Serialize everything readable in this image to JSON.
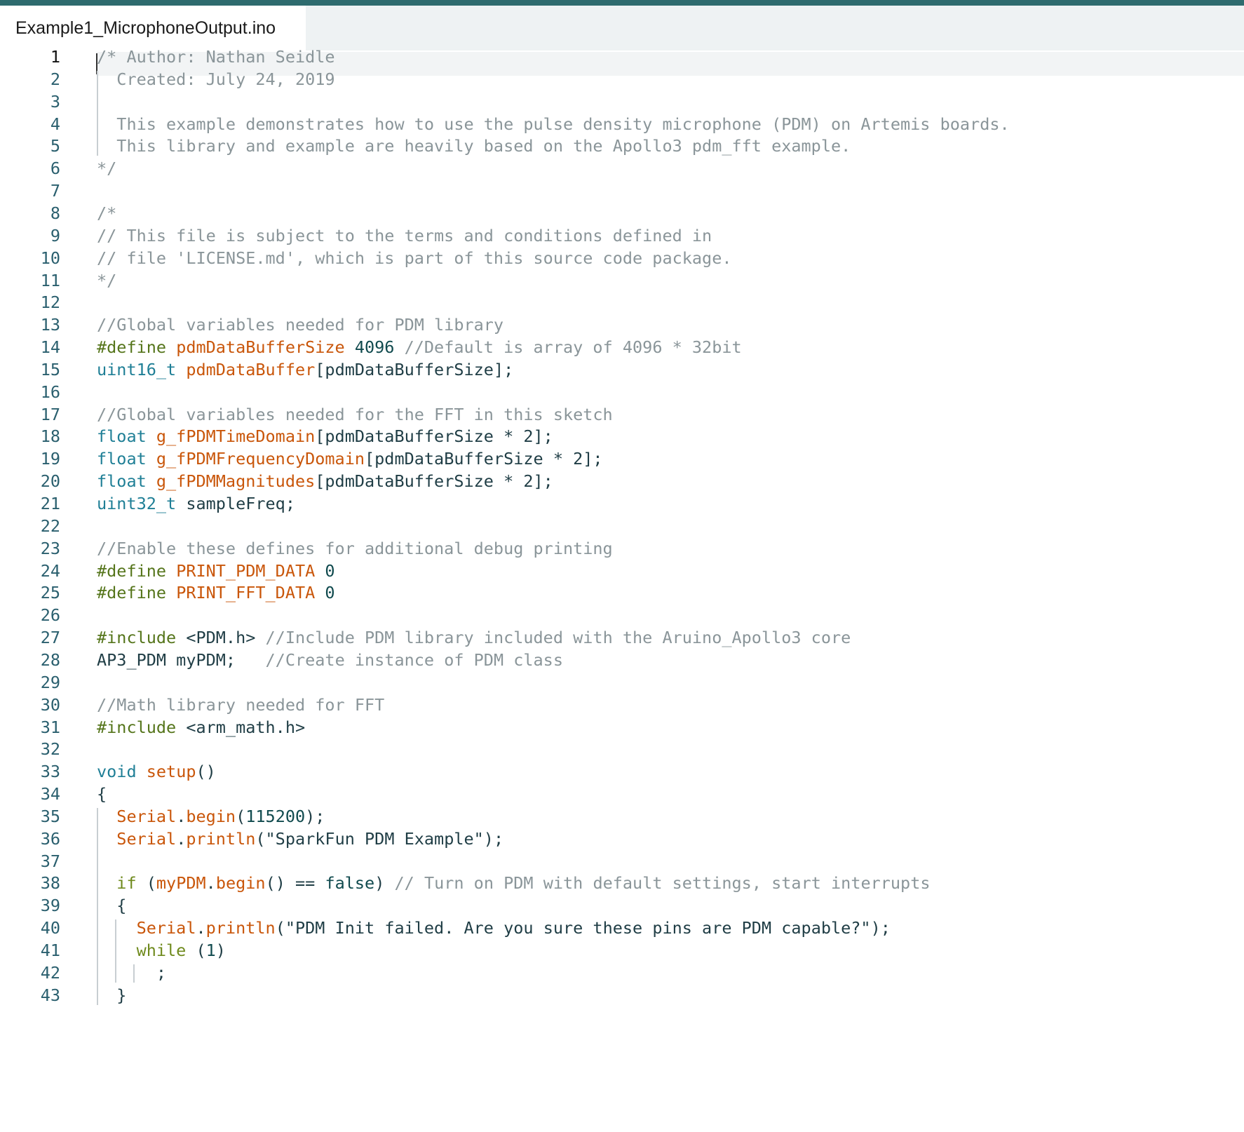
{
  "editor": {
    "tab_label": "Example1_MicrophoneOutput.ino",
    "active_line": 1,
    "colors": {
      "top_bar": "#2e6b6e",
      "comment": "#8a9599",
      "directive": "#55751b",
      "type": "#1f7f96",
      "function": "#c9560a",
      "number": "#104a4e",
      "keyword": "#6f8a1d",
      "text": "#1f3d45"
    },
    "lines": [
      {
        "n": "1",
        "tokens": [
          [
            "c-com",
            "/* Author: Nathan Seidle"
          ]
        ]
      },
      {
        "n": "2",
        "tokens": [
          [
            "c-com",
            "  Created: July 24, 2019"
          ]
        ]
      },
      {
        "n": "3",
        "tokens": []
      },
      {
        "n": "4",
        "tokens": [
          [
            "c-com",
            "  This example demonstrates how to use the pulse density microphone (PDM) on Artemis boards."
          ]
        ]
      },
      {
        "n": "5",
        "tokens": [
          [
            "c-com",
            "  This library and example are heavily based on the Apollo3 pdm_fft example."
          ]
        ]
      },
      {
        "n": "6",
        "tokens": [
          [
            "c-com",
            "*/"
          ]
        ]
      },
      {
        "n": "7",
        "tokens": []
      },
      {
        "n": "8",
        "tokens": [
          [
            "c-com",
            "/*"
          ]
        ]
      },
      {
        "n": "9",
        "tokens": [
          [
            "c-com",
            "// This file is subject to the terms and conditions defined in"
          ]
        ]
      },
      {
        "n": "10",
        "tokens": [
          [
            "c-com",
            "// file 'LICENSE.md', which is part of this source code package."
          ]
        ]
      },
      {
        "n": "11",
        "tokens": [
          [
            "c-com",
            "*/"
          ]
        ]
      },
      {
        "n": "12",
        "tokens": []
      },
      {
        "n": "13",
        "tokens": [
          [
            "c-com",
            "//Global variables needed for PDM library"
          ]
        ]
      },
      {
        "n": "14",
        "tokens": [
          [
            "c-dir",
            "#define "
          ],
          [
            "c-fn",
            "pdmDataBufferSize "
          ],
          [
            "c-num",
            "4096 "
          ],
          [
            "c-com",
            "//Default is array of 4096 * 32bit"
          ]
        ]
      },
      {
        "n": "15",
        "tokens": [
          [
            "c-typ",
            "uint16_t "
          ],
          [
            "c-fn",
            "pdmDataBuffer"
          ],
          [
            "c-txt",
            "[pdmDataBufferSize];"
          ]
        ]
      },
      {
        "n": "16",
        "tokens": []
      },
      {
        "n": "17",
        "tokens": [
          [
            "c-com",
            "//Global variables needed for the FFT in this sketch"
          ]
        ]
      },
      {
        "n": "18",
        "tokens": [
          [
            "c-typ",
            "float "
          ],
          [
            "c-fn",
            "g_fPDMTimeDomain"
          ],
          [
            "c-txt",
            "[pdmDataBufferSize * 2];"
          ]
        ]
      },
      {
        "n": "19",
        "tokens": [
          [
            "c-typ",
            "float "
          ],
          [
            "c-fn",
            "g_fPDMFrequencyDomain"
          ],
          [
            "c-txt",
            "[pdmDataBufferSize * 2];"
          ]
        ]
      },
      {
        "n": "20",
        "tokens": [
          [
            "c-typ",
            "float "
          ],
          [
            "c-fn",
            "g_fPDMMagnitudes"
          ],
          [
            "c-txt",
            "[pdmDataBufferSize * 2];"
          ]
        ]
      },
      {
        "n": "21",
        "tokens": [
          [
            "c-typ",
            "uint32_t "
          ],
          [
            "c-txt",
            "sampleFreq;"
          ]
        ]
      },
      {
        "n": "22",
        "tokens": []
      },
      {
        "n": "23",
        "tokens": [
          [
            "c-com",
            "//Enable these defines for additional debug printing"
          ]
        ]
      },
      {
        "n": "24",
        "tokens": [
          [
            "c-dir",
            "#define "
          ],
          [
            "c-fn",
            "PRINT_PDM_DATA "
          ],
          [
            "c-num",
            "0"
          ]
        ]
      },
      {
        "n": "25",
        "tokens": [
          [
            "c-dir",
            "#define "
          ],
          [
            "c-fn",
            "PRINT_FFT_DATA "
          ],
          [
            "c-num",
            "0"
          ]
        ]
      },
      {
        "n": "26",
        "tokens": []
      },
      {
        "n": "27",
        "tokens": [
          [
            "c-dir",
            "#include "
          ],
          [
            "c-txt",
            "<PDM.h> "
          ],
          [
            "c-com",
            "//Include PDM library included with the Aruino_Apollo3 core"
          ]
        ]
      },
      {
        "n": "28",
        "tokens": [
          [
            "c-txt",
            "AP3_PDM myPDM;   "
          ],
          [
            "c-com",
            "//Create instance of PDM class"
          ]
        ]
      },
      {
        "n": "29",
        "tokens": []
      },
      {
        "n": "30",
        "tokens": [
          [
            "c-com",
            "//Math library needed for FFT"
          ]
        ]
      },
      {
        "n": "31",
        "tokens": [
          [
            "c-dir",
            "#include "
          ],
          [
            "c-txt",
            "<arm_math.h>"
          ]
        ]
      },
      {
        "n": "32",
        "tokens": []
      },
      {
        "n": "33",
        "tokens": [
          [
            "c-typ",
            "void "
          ],
          [
            "c-fn",
            "setup"
          ],
          [
            "c-txt",
            "()"
          ]
        ]
      },
      {
        "n": "34",
        "tokens": [
          [
            "c-txt",
            "{"
          ]
        ]
      },
      {
        "n": "35",
        "tokens": [
          [
            "c-txt",
            "  "
          ],
          [
            "c-fn",
            "Serial"
          ],
          [
            "c-txt",
            "."
          ],
          [
            "c-fn",
            "begin"
          ],
          [
            "c-txt",
            "("
          ],
          [
            "c-num",
            "115200"
          ],
          [
            "c-txt",
            ");"
          ]
        ]
      },
      {
        "n": "36",
        "tokens": [
          [
            "c-txt",
            "  "
          ],
          [
            "c-fn",
            "Serial"
          ],
          [
            "c-txt",
            "."
          ],
          [
            "c-fn",
            "println"
          ],
          [
            "c-str",
            "(\"SparkFun PDM Example\");"
          ]
        ]
      },
      {
        "n": "37",
        "tokens": []
      },
      {
        "n": "38",
        "tokens": [
          [
            "c-txt",
            "  "
          ],
          [
            "c-kw",
            "if "
          ],
          [
            "c-txt",
            "("
          ],
          [
            "c-fn",
            "myPDM"
          ],
          [
            "c-txt",
            "."
          ],
          [
            "c-fn",
            "begin"
          ],
          [
            "c-txt",
            "() == "
          ],
          [
            "c-num",
            "false"
          ],
          [
            "c-txt",
            ") "
          ],
          [
            "c-com",
            "// Turn on PDM with default settings, start interrupts"
          ]
        ]
      },
      {
        "n": "39",
        "tokens": [
          [
            "c-txt",
            "  {"
          ]
        ]
      },
      {
        "n": "40",
        "tokens": [
          [
            "c-txt",
            "    "
          ],
          [
            "c-fn",
            "Serial"
          ],
          [
            "c-txt",
            "."
          ],
          [
            "c-fn",
            "println"
          ],
          [
            "c-str",
            "(\"PDM Init failed. Are you sure these pins are PDM capable?\");"
          ]
        ]
      },
      {
        "n": "41",
        "tokens": [
          [
            "c-txt",
            "    "
          ],
          [
            "c-kw",
            "while "
          ],
          [
            "c-txt",
            "("
          ],
          [
            "c-num",
            "1"
          ],
          [
            "c-txt",
            ")"
          ]
        ]
      },
      {
        "n": "42",
        "tokens": [
          [
            "c-txt",
            "      ;"
          ]
        ]
      },
      {
        "n": "43",
        "tokens": [
          [
            "c-txt",
            "  }"
          ]
        ]
      }
    ]
  }
}
